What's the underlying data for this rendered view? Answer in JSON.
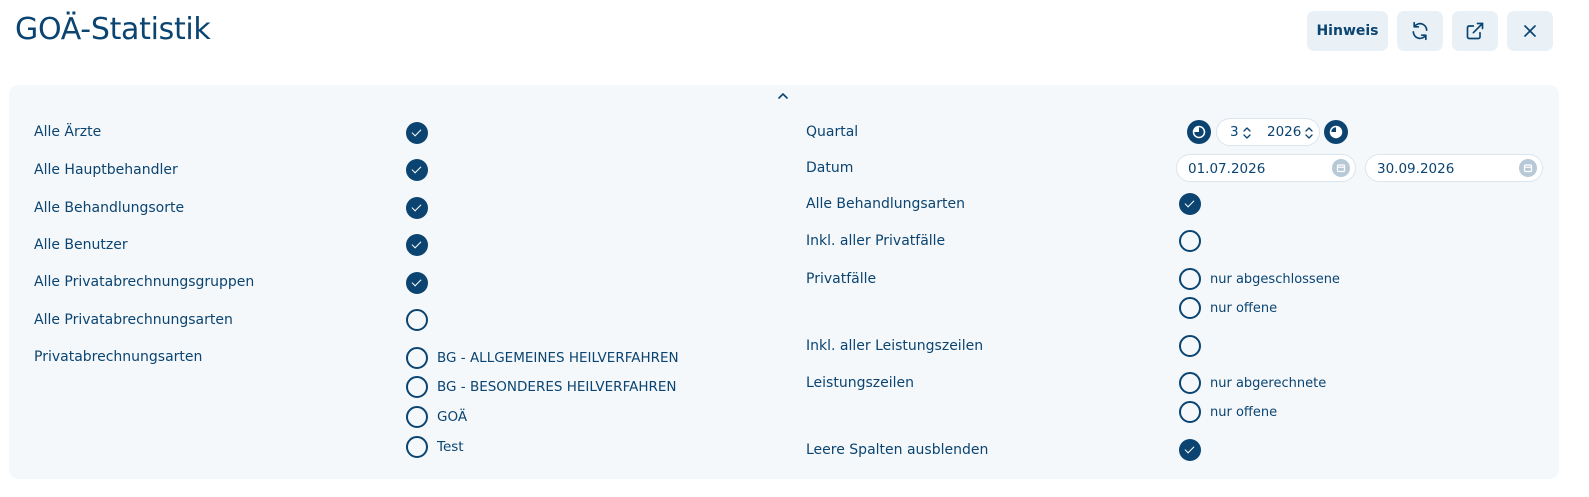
{
  "page": {
    "title": "GOÄ-Statistik"
  },
  "toolbar": {
    "hint_label": "Hinweis",
    "refresh_icon": "refresh-icon",
    "open_external_icon": "external-link-icon",
    "close_icon": "close-icon"
  },
  "colors": {
    "primary": "#0b4470",
    "panel_bg": "#f4f8fb",
    "button_bg": "#e9f1f7",
    "calendar_icon": "#b7c9d7"
  },
  "left": {
    "alle_aerzte": "Alle Ärzte",
    "alle_hauptbehandler": "Alle Hauptbehandler",
    "alle_behandlungsorte": "Alle Behandlungsorte",
    "alle_benutzer": "Alle Benutzer",
    "alle_privatabrechnungsgruppen": "Alle Privatabrechnungsgruppen",
    "alle_privatabrechnungsarten": "Alle Privatabrechnungsarten",
    "privatabrechnungsarten": "Privatabrechnungsarten",
    "arten_options": [
      "BG - ALLGEMEINES HEILVERFAHREN",
      "BG - BESONDERES HEILVERFAHREN",
      "GOÄ",
      "Test"
    ]
  },
  "right": {
    "quartal": "Quartal",
    "quartal_value": "3",
    "jahr_value": "2026",
    "datum": "Datum",
    "datum_von": "01.07.2026",
    "datum_bis": "30.09.2026",
    "alle_behandlungsarten": "Alle Behandlungsarten",
    "inkl_privatfaelle": "Inkl. aller Privatfälle",
    "privatfaelle": "Privatfälle",
    "privatfaelle_options": [
      "nur abgeschlossene",
      "nur offene"
    ],
    "inkl_leistungszeilen": "Inkl. aller Leistungszeilen",
    "leistungszeilen": "Leistungszeilen",
    "leistungszeilen_options": [
      "nur abgerechnete",
      "nur offene"
    ],
    "leere_spalten": "Leere Spalten ausblenden"
  },
  "state": {
    "alle_aerzte": true,
    "alle_hauptbehandler": true,
    "alle_behandlungsorte": true,
    "alle_benutzer": true,
    "alle_privatabrechnungsgruppen": true,
    "alle_privatabrechnungsarten": false,
    "arten_options": [
      false,
      false,
      false,
      false
    ],
    "alle_behandlungsarten": true,
    "inkl_privatfaelle": false,
    "privatfaelle_options": [
      false,
      false
    ],
    "inkl_leistungszeilen": false,
    "leistungszeilen_options": [
      false,
      false
    ],
    "leere_spalten": true
  }
}
